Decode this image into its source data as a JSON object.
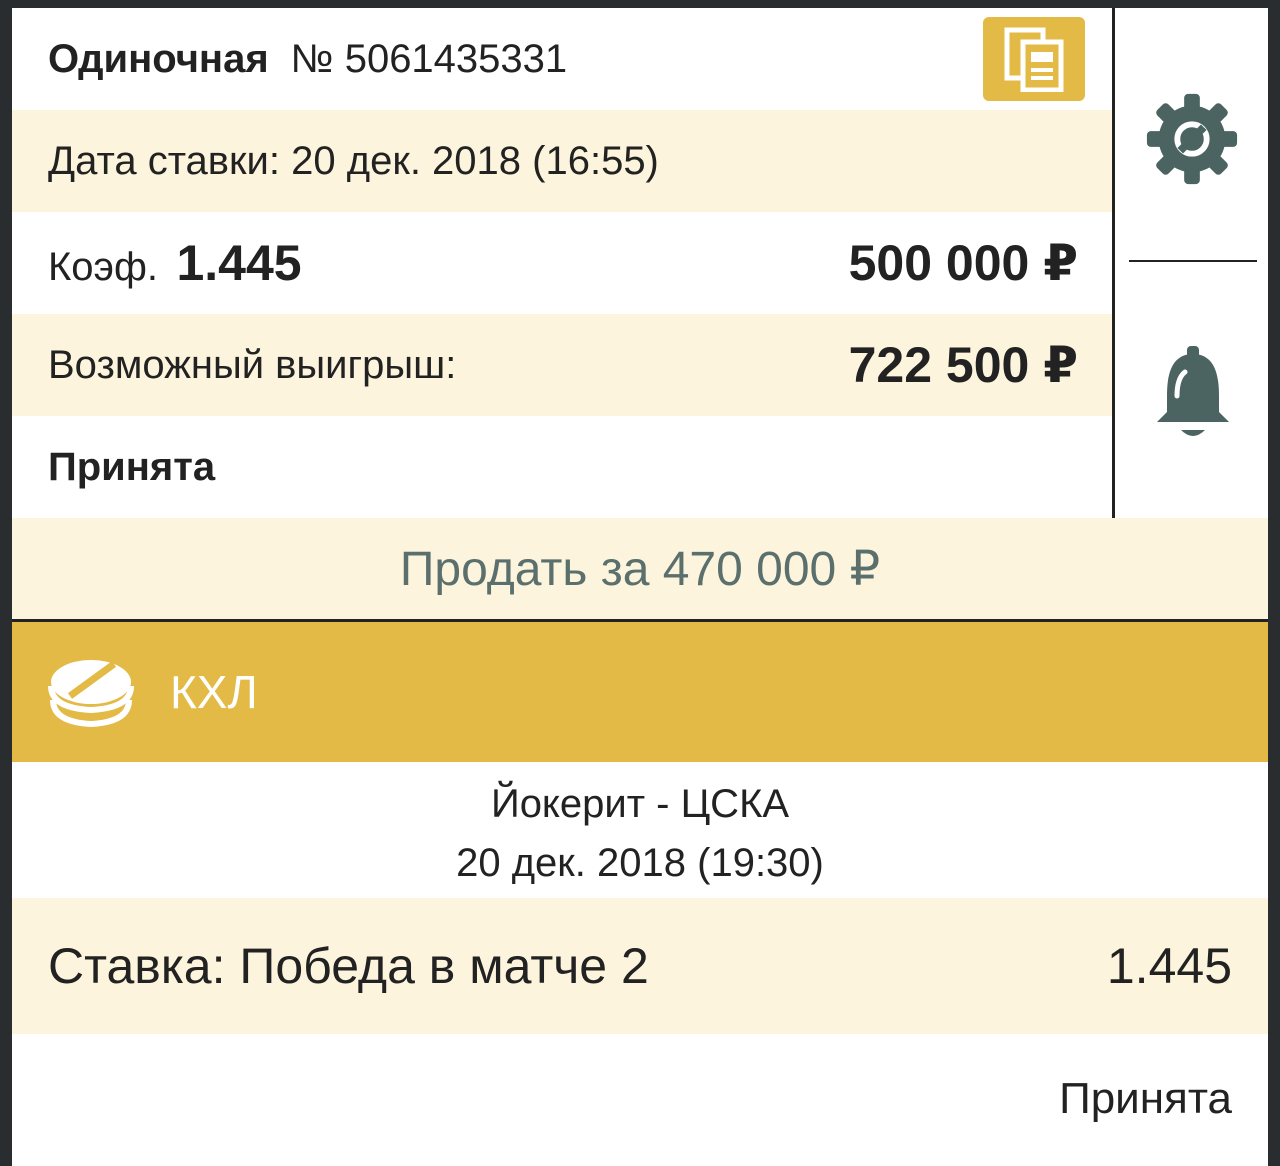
{
  "header": {
    "type": "Одиночная",
    "number": "№ 5061435331"
  },
  "date_row": {
    "text": "Дата ставки: 20 дек. 2018 (16:55)"
  },
  "coef_row": {
    "label": "Коэф.",
    "value": "1.445",
    "stake": "500 000 ₽"
  },
  "win_row": {
    "label": "Возможный выигрыш:",
    "value": "722 500 ₽"
  },
  "status": "Принята",
  "sell_button": {
    "label": "Продать за 470 000 ₽"
  },
  "league": {
    "name": "КХЛ",
    "icon": "hockey-puck-icon"
  },
  "match": {
    "teams": "Йокерит - ЦСКА",
    "date": "20 дек. 2018 (19:30)"
  },
  "bet": {
    "label": "Ставка: Победа в матче 2",
    "coef": "1.445"
  },
  "bet_status": "Принята",
  "colors": {
    "accent": "#e3ba46",
    "cream": "#fcf4dc",
    "icon": "#4b6462",
    "sell_text": "#5b6f6d"
  },
  "side_icons": [
    "gear-icon",
    "bell-icon"
  ]
}
